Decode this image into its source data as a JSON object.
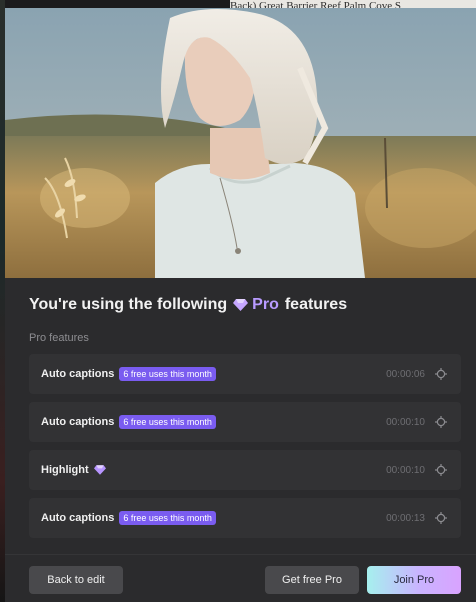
{
  "backdrop": {
    "text": "Back)  Great Barrier Reef  Palm Cove  S"
  },
  "modal": {
    "title_prefix": "You're using the following",
    "title_pro": "Pro",
    "title_suffix": "features",
    "section_label": "Pro features",
    "features": [
      {
        "label": "Auto captions",
        "badge": "6 free uses this month",
        "time": "00:00:06",
        "has_badge": true
      },
      {
        "label": "Auto captions",
        "badge": "6 free uses this month",
        "time": "00:00:10",
        "has_badge": true
      },
      {
        "label": "Highlight",
        "badge": "",
        "time": "00:00:10",
        "has_badge": false
      },
      {
        "label": "Auto captions",
        "badge": "6 free uses this month",
        "time": "00:00:13",
        "has_badge": true
      }
    ],
    "buttons": {
      "back": "Back to edit",
      "free": "Get free Pro",
      "join": "Join Pro"
    }
  },
  "colors": {
    "accent_purple": "#7a5cf0",
    "pro_text": "#b89bff",
    "join_gradient_start": "#a6f0ee",
    "join_gradient_end": "#d9a3ff"
  },
  "icons": {
    "pro": "diamond-gem-icon",
    "locate": "crosshair-target-icon"
  }
}
